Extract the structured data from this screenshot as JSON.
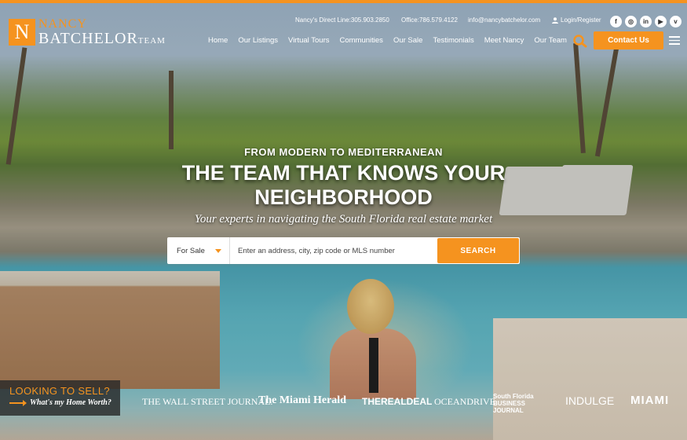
{
  "brand": {
    "logo_letter": "N",
    "first_name": "NANCY",
    "last_name": "BATCHELOR",
    "team": "TEAM",
    "accent_color": "#f5931f"
  },
  "utility": {
    "direct_line": "Nancy's Direct Line:305.903.2850",
    "office": "Office:786.579.4122",
    "email": "info@nancybatchelor.com",
    "login": "Login/Register",
    "login_icon": "user-icon"
  },
  "social": [
    {
      "name": "facebook",
      "glyph": "f"
    },
    {
      "name": "instagram",
      "glyph": "◎"
    },
    {
      "name": "linkedin",
      "glyph": "in"
    },
    {
      "name": "youtube",
      "glyph": "▶"
    },
    {
      "name": "vimeo",
      "glyph": "v"
    }
  ],
  "nav": {
    "items": [
      "Home",
      "Our Listings",
      "Virtual Tours",
      "Communities",
      "Our Sale",
      "Testimonials",
      "Meet Nancy",
      "Our Team"
    ],
    "search_icon": "search-icon",
    "contact_label": "Contact Us",
    "menu_icon": "hamburger-menu-icon"
  },
  "hero": {
    "kicker": "FROM MODERN TO MEDITERRANEAN",
    "headline": "THE TEAM THAT KNOWS YOUR NEIGHBORHOOD",
    "tagline": "Your experts in navigating the South Florida real estate market"
  },
  "search": {
    "type_value": "For Sale",
    "placeholder": "Enter an address, city, zip code or MLS number",
    "button_label": "SEARCH"
  },
  "sell_cta": {
    "title": "LOOKING TO SELL?",
    "link": "What's my Home Worth?"
  },
  "press": [
    "THE WALL STREET JOURNAL.",
    "The Miami Herald",
    "THEREALDEAL",
    "OCEANDRIVE",
    "South Florida BUSINESS JOURNAL",
    "INDULGE",
    "MIAMI"
  ]
}
